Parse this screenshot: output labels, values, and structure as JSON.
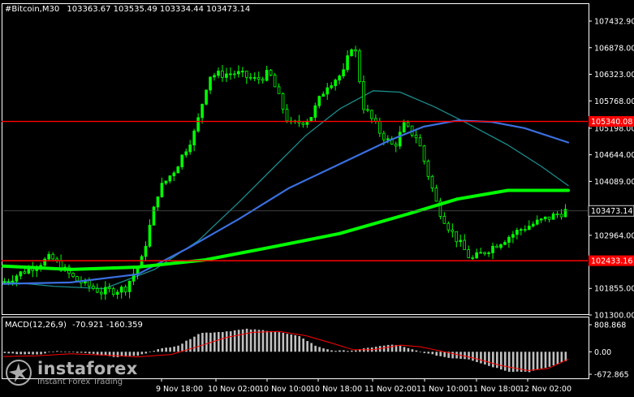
{
  "header": {
    "symbol": "#Bitcoin,M30",
    "ohlc": "103363.67 103535.49 103334.44 103473.14"
  },
  "macd_header": {
    "label": "MACD(12,26,9)",
    "values": "-70.921 -160.359"
  },
  "watermark": {
    "brand": "instaforex",
    "tagline": "Instant Forex Trading"
  },
  "colors": {
    "background": "#000000",
    "candle": "#00ff00",
    "ma_fast": "#1b8c8c",
    "ma_mid": "#3a6fe0",
    "ma_slow": "#00ff00",
    "hline": "#ff0000",
    "hline_label_bg": "#ff0000",
    "price_label_bg": "#000000",
    "macd_hist": "#c0c0c0",
    "macd_signal": "#ff0000",
    "axis_text": "#ffffff"
  },
  "chart_data": [
    {
      "type": "candlestick",
      "title": "#Bitcoin,M30",
      "y_ticks": [
        107432.9,
        106878.0,
        106323.0,
        105768.0,
        105198.0,
        104644.0,
        104089.0,
        102964.0,
        101855.0,
        101300.0
      ],
      "ylim": [
        101300.0,
        107432.9
      ],
      "x_ticks": [
        "9 Nov 18:00",
        "10 Nov 02:00",
        "10 Nov 10:00",
        "10 Nov 18:00",
        "11 Nov 02:00",
        "11 Nov 10:00",
        "11 Nov 18:00",
        "12 Nov 02:00"
      ],
      "current_price": 103473.14,
      "horizontal_lines": [
        105340.08,
        102433.16
      ],
      "candle_count": 140,
      "path_anchors": [
        [
          0,
          101950
        ],
        [
          8,
          102250
        ],
        [
          15,
          102500
        ],
        [
          22,
          102050
        ],
        [
          30,
          101780
        ],
        [
          37,
          101850
        ],
        [
          42,
          102450
        ],
        [
          47,
          103900
        ],
        [
          52,
          104350
        ],
        [
          58,
          105150
        ],
        [
          62,
          106300
        ],
        [
          70,
          106350
        ],
        [
          76,
          106200
        ],
        [
          80,
          106350
        ],
        [
          86,
          105250
        ],
        [
          92,
          105400
        ],
        [
          97,
          106100
        ],
        [
          102,
          106350
        ],
        [
          105,
          107050
        ],
        [
          108,
          105650
        ],
        [
          113,
          105100
        ],
        [
          117,
          104800
        ],
        [
          120,
          105250
        ],
        [
          124,
          105000
        ],
        [
          130,
          103550
        ],
        [
          134,
          103050
        ],
        [
          140,
          102450
        ],
        [
          148,
          102800
        ],
        [
          155,
          103100
        ],
        [
          162,
          103300
        ],
        [
          168,
          103470
        ]
      ],
      "moving_averages": [
        {
          "color": "ma_fast",
          "points": [
            [
              0,
              102000
            ],
            [
              15,
              101900
            ],
            [
              30,
              101850
            ],
            [
              45,
              102250
            ],
            [
              58,
              102850
            ],
            [
              70,
              103650
            ],
            [
              80,
              104350
            ],
            [
              90,
              105050
            ],
            [
              100,
              105600
            ],
            [
              110,
              105980
            ],
            [
              118,
              105950
            ],
            [
              128,
              105650
            ],
            [
              138,
              105300
            ],
            [
              150,
              104850
            ],
            [
              160,
              104400
            ],
            [
              168,
              104000
            ]
          ]
        },
        {
          "color": "ma_mid",
          "points": [
            [
              0,
              101950
            ],
            [
              20,
              101980
            ],
            [
              40,
              102150
            ],
            [
              55,
              102700
            ],
            [
              70,
              103300
            ],
            [
              85,
              103950
            ],
            [
              100,
              104450
            ],
            [
              115,
              104950
            ],
            [
              125,
              105230
            ],
            [
              135,
              105360
            ],
            [
              145,
              105330
            ],
            [
              155,
              105200
            ],
            [
              168,
              104900
            ]
          ]
        },
        {
          "color": "ma_slow",
          "points": [
            [
              0,
              102320
            ],
            [
              20,
              102250
            ],
            [
              40,
              102300
            ],
            [
              60,
              102450
            ],
            [
              80,
              102720
            ],
            [
              100,
              103000
            ],
            [
              120,
              103400
            ],
            [
              135,
              103720
            ],
            [
              150,
              103900
            ],
            [
              168,
              103900
            ]
          ]
        }
      ]
    },
    {
      "type": "bar",
      "title": "MACD(12,26,9)",
      "values_text": "-70.921 -160.359",
      "y_ticks": [
        808.868,
        0.0,
        -672.865
      ],
      "ylim": [
        -672.865,
        808.868
      ],
      "histogram_anchors": [
        [
          0,
          -50
        ],
        [
          10,
          -90
        ],
        [
          15,
          20
        ],
        [
          25,
          -40
        ],
        [
          33,
          -160
        ],
        [
          40,
          -110
        ],
        [
          45,
          60
        ],
        [
          52,
          200
        ],
        [
          58,
          560
        ],
        [
          65,
          600
        ],
        [
          72,
          680
        ],
        [
          80,
          620
        ],
        [
          88,
          450
        ],
        [
          93,
          150
        ],
        [
          98,
          30
        ],
        [
          104,
          40
        ],
        [
          110,
          150
        ],
        [
          116,
          220
        ],
        [
          120,
          100
        ],
        [
          126,
          -60
        ],
        [
          132,
          -180
        ],
        [
          138,
          -220
        ],
        [
          144,
          -420
        ],
        [
          150,
          -590
        ],
        [
          156,
          -600
        ],
        [
          162,
          -450
        ],
        [
          168,
          -240
        ]
      ],
      "signal_anchors": [
        [
          0,
          -140
        ],
        [
          10,
          -120
        ],
        [
          20,
          -60
        ],
        [
          30,
          -100
        ],
        [
          40,
          -150
        ],
        [
          50,
          -80
        ],
        [
          58,
          160
        ],
        [
          66,
          420
        ],
        [
          74,
          580
        ],
        [
          82,
          610
        ],
        [
          90,
          480
        ],
        [
          98,
          250
        ],
        [
          104,
          60
        ],
        [
          110,
          60
        ],
        [
          118,
          200
        ],
        [
          124,
          150
        ],
        [
          132,
          -20
        ],
        [
          140,
          -190
        ],
        [
          148,
          -410
        ],
        [
          156,
          -560
        ],
        [
          162,
          -500
        ],
        [
          168,
          -220
        ]
      ]
    }
  ]
}
